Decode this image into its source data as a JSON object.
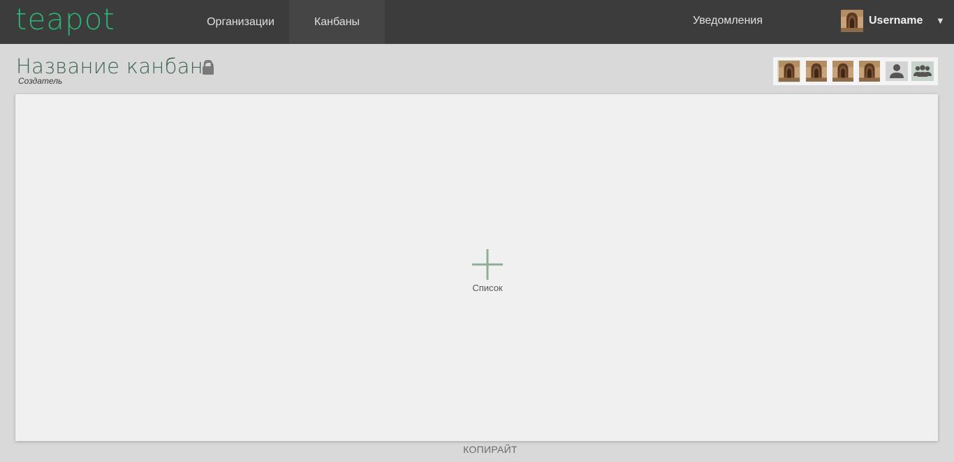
{
  "header": {
    "logo": "teapot",
    "nav": [
      {
        "label": "Организации",
        "active": false
      },
      {
        "label": "Канбаны",
        "active": true
      }
    ],
    "notifications_label": "Уведомления",
    "user": {
      "name": "Username",
      "avatar_icon": "user-photo"
    },
    "menu_caret": "▼"
  },
  "board": {
    "title": "Название канбана",
    "private_icon": "lock-icon",
    "creator": "Создатель",
    "add_list_label": "Список"
  },
  "members": {
    "avatars": [
      "user-photo",
      "user-photo",
      "user-photo",
      "user-photo"
    ],
    "add_member_icon": "person-icon",
    "team_icon": "group-icon"
  },
  "footer": {
    "text": "КОПИРАЙТ"
  },
  "colors": {
    "topbar": "#3c3c3c",
    "brand": "#2bb673",
    "title": "#3f6650",
    "page_bg": "#d9d9d9",
    "board_bg": "#f0f0f0",
    "plus": "#8fae98"
  }
}
